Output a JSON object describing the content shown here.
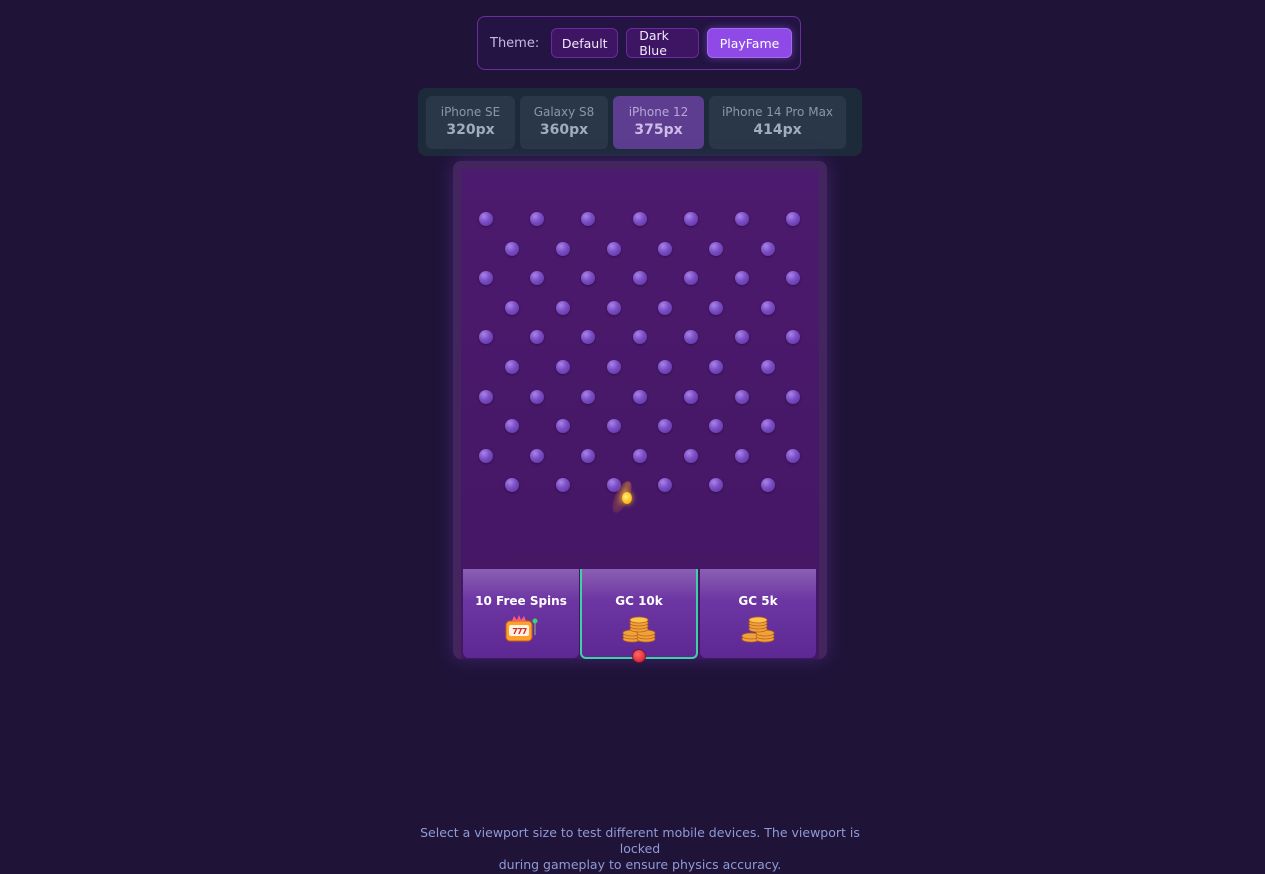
{
  "theme": {
    "label": "Theme:",
    "options": [
      "Default",
      "Dark Blue",
      "PlayFame"
    ],
    "active": "PlayFame"
  },
  "viewports": [
    {
      "name": "iPhone SE",
      "size": "320px"
    },
    {
      "name": "Galaxy S8",
      "size": "360px"
    },
    {
      "name": "iPhone 12",
      "size": "375px",
      "active": true
    },
    {
      "name": "iPhone 14 Pro Max",
      "size": "414px"
    }
  ],
  "slots": [
    {
      "label": "10 Free Spins",
      "icon": "slot-machine-icon"
    },
    {
      "label": "GC 10k",
      "icon": "coin-stack-icon",
      "highlighted": true
    },
    {
      "label": "GC 5k",
      "icon": "coin-stack-icon"
    }
  ],
  "board": {
    "peg_rows": 10,
    "pegs_even_row": 7,
    "pegs_odd_row": 6
  },
  "footer": {
    "line1": "Select a viewport size to test different mobile devices. The viewport is locked",
    "line2": "during gameplay to ensure physics accuracy."
  },
  "colors": {
    "background": "#1f1438",
    "accent": "#8f49e6",
    "board": "#4c1a6e",
    "highlight": "#3ed1a6",
    "ball": "#ffc21a"
  }
}
